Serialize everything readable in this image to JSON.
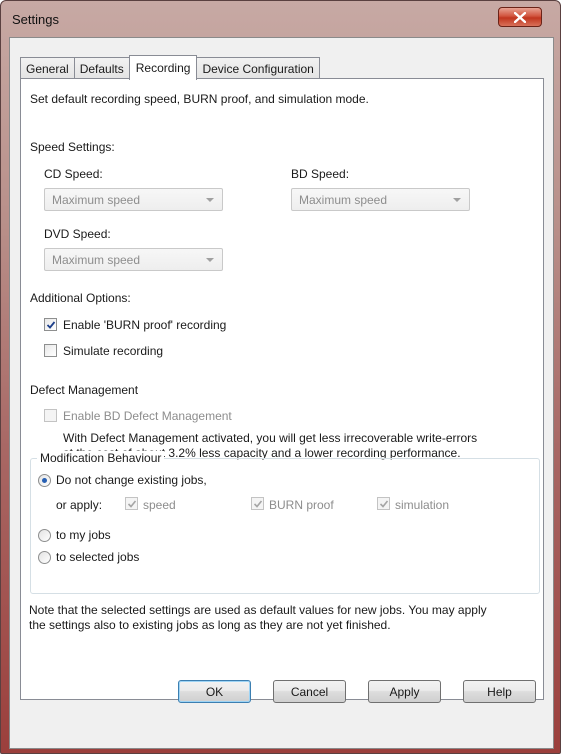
{
  "window": {
    "title": "Settings"
  },
  "tabs": [
    {
      "label": "General"
    },
    {
      "label": "Defaults"
    },
    {
      "label": "Recording"
    },
    {
      "label": "Device Configuration"
    }
  ],
  "active_tab": "Recording",
  "description": "Set default recording speed, BURN proof, and simulation mode.",
  "speed": {
    "heading": "Speed Settings:",
    "cd_label": "CD Speed:",
    "cd_value": "Maximum speed",
    "bd_label": "BD Speed:",
    "bd_value": "Maximum speed",
    "dvd_label": "DVD Speed:",
    "dvd_value": "Maximum speed"
  },
  "additional": {
    "heading": "Additional Options:",
    "burn_proof_label": "Enable 'BURN proof' recording",
    "burn_proof_checked": true,
    "simulate_label": "Simulate recording",
    "simulate_checked": false
  },
  "defect": {
    "heading": "Defect Management",
    "enable_label": "Enable BD Defect Management",
    "enable_checked": false,
    "note_line1": "With Defect Management activated, you will get less irrecoverable write-errors",
    "note_line2": "at the cost of about 3.2% less capacity and a lower recording performance."
  },
  "modification": {
    "heading": "Modification Behaviour",
    "option_none": "Do not change existing jobs,",
    "or_apply": "or apply:",
    "apply_speed": "speed",
    "apply_burn": "BURN proof",
    "apply_sim": "simulation",
    "option_my_jobs": "to my jobs",
    "option_selected": "to selected jobs",
    "selected": "Do not change existing jobs,"
  },
  "footer_note": {
    "line1": "Note that the selected settings are used as default values for new jobs. You may apply",
    "line2": "the settings also to existing jobs as long as they are not yet finished."
  },
  "buttons": {
    "ok": "OK",
    "cancel": "Cancel",
    "apply": "Apply",
    "help": "Help"
  }
}
